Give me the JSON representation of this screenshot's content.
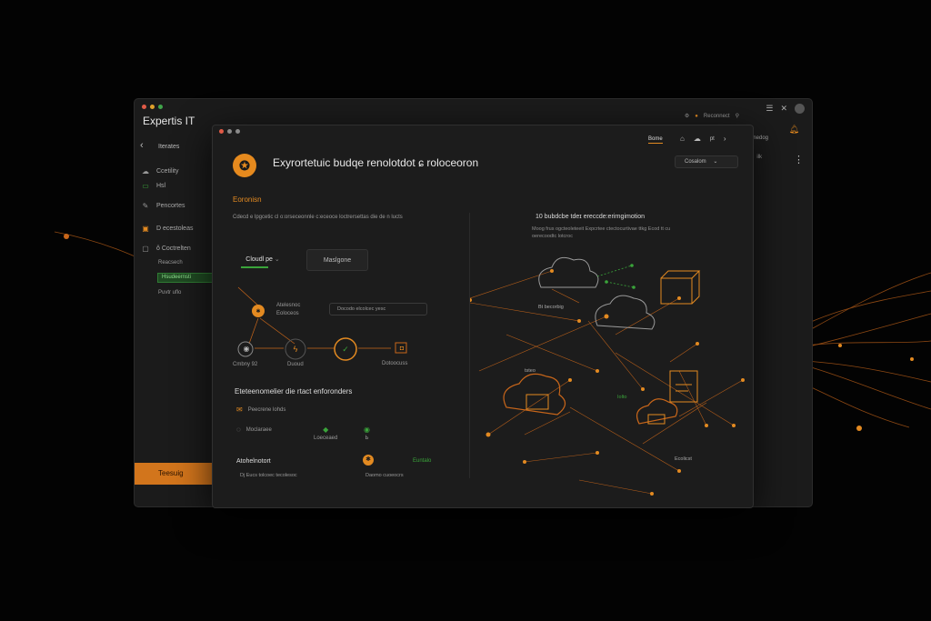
{
  "colors": {
    "accent": "#e38a21",
    "green": "#3aa43a",
    "background": "#030303",
    "panel": "#1c1c1c"
  },
  "back_window": {
    "title": "Expertis IT",
    "top_status": "Reconnect",
    "nav_back": "Iterates",
    "sidebar": {
      "items": [
        {
          "icon": "cloud-icon",
          "label": "Ccetility"
        },
        {
          "icon": "monitor-icon",
          "label": "Hsl"
        },
        {
          "icon": "wrench-icon",
          "label": "Pencortes"
        },
        {
          "icon": "grid-icon",
          "label": "D ecestoleas"
        },
        {
          "icon": "chart-icon",
          "label": "ǒ Coctrelten"
        }
      ],
      "subitem": "Reacsech",
      "active_item": "Hsudeernsti",
      "subitem_2": "Puvtr uflo"
    },
    "bottom_button": "Teesuig",
    "right_label": "dnedog",
    "right_item": "ilk"
  },
  "front_window": {
    "top_link": "Bome",
    "top_link_2": "pt",
    "title": "Exyrortetuic budqe renolotdot ɕ roloceoron",
    "dropdown": "Cosalom",
    "section_label": "Eoronisn",
    "description": "Cdecd e lpgcetic cl o:orseceonnle c:eceoce loctrersettas die de n lucts",
    "tabs": [
      "Cloudl pe",
      "Maslgone"
    ],
    "flow": {
      "node_top_title": "Atelesnoc",
      "node_top_sub": "Eoloceos",
      "pill": "Docodo elcolcec yesc",
      "node_labels": [
        "Cmbny 92",
        "Duoud",
        "",
        "Dotoocuss"
      ]
    },
    "lower": {
      "heading": "Eteteenomelier die rtact enforonders",
      "rows": [
        {
          "icon": "shield-icon",
          "label": "Peecrene lohds"
        },
        {
          "icon": "clock-icon",
          "label": "Moclaraee"
        },
        {
          "icon": "check-icon",
          "label": "Loeceaed"
        },
        {
          "icon": "check-icon",
          "label": "Ь"
        }
      ],
      "bottom_heading": "Atohelnotort",
      "bottom_sub": "Dj Eucs tolcoec tecolesoc",
      "bottom_right_label": "Euntalo",
      "bottom_right_sub": "Daomo cuoeocrs"
    },
    "network": {
      "heading": "10 bubdcbe tdeɪ ereccde:erirngimotion",
      "subtext": "Moog frus  ogcteoleteeit  Expcrtee ctectocurtivae ttkg  Ecod tt cu oerecoodtc lotcroc",
      "labels": [
        "Bt becorbig",
        "tsteo",
        "Iolto",
        "Ecolicst"
      ]
    }
  }
}
